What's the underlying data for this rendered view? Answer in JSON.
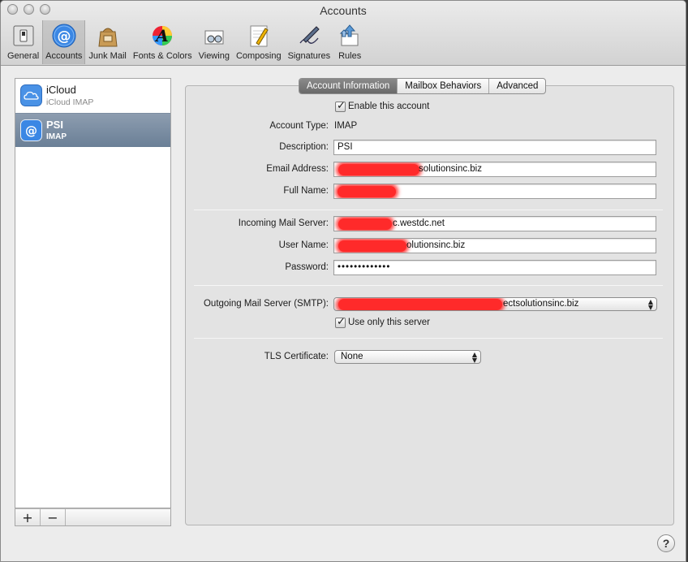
{
  "window": {
    "title": "Accounts"
  },
  "toolbar": {
    "items": [
      {
        "label": "General",
        "icon": "general-switch-icon"
      },
      {
        "label": "Accounts",
        "icon": "at-sign-icon",
        "selected": true
      },
      {
        "label": "Junk Mail",
        "icon": "junk-mail-bag-icon"
      },
      {
        "label": "Fonts & Colors",
        "icon": "fonts-colors-icon"
      },
      {
        "label": "Viewing",
        "icon": "viewing-glasses-icon"
      },
      {
        "label": "Composing",
        "icon": "composing-pencil-icon"
      },
      {
        "label": "Signatures",
        "icon": "signature-pen-icon"
      },
      {
        "label": "Rules",
        "icon": "rules-arrows-icon"
      }
    ]
  },
  "accounts": [
    {
      "name": "iCloud",
      "type": "iCloud IMAP",
      "icon": "icloud-icon"
    },
    {
      "name": "PSI",
      "type": "IMAP",
      "icon": "at-sign-icon",
      "selected": true
    }
  ],
  "list_footer": {
    "add": "+",
    "remove": "−"
  },
  "tabs": [
    {
      "label": "Account Information",
      "active": true
    },
    {
      "label": "Mailbox Behaviors"
    },
    {
      "label": "Advanced"
    }
  ],
  "form": {
    "enable_label": "Enable this account",
    "account_type_label": "Account Type:",
    "account_type_value": "IMAP",
    "description_label": "Description:",
    "description_value": "PSI",
    "email_label": "Email Address:",
    "email_value": "solutionsinc.biz",
    "fullname_label": "Full Name:",
    "fullname_value": "",
    "incoming_label": "Incoming Mail Server:",
    "incoming_value": "c.westdc.net",
    "username_label": "User Name:",
    "username_value": "olutionsinc.biz",
    "password_label": "Password:",
    "password_value": "•••••••••••••",
    "smtp_label": "Outgoing Mail Server (SMTP):",
    "smtp_value": "ectsolutionsinc.biz",
    "use_only_label": "Use only this server",
    "tls_label": "TLS Certificate:",
    "tls_value": "None"
  },
  "help": {
    "label": "?"
  },
  "colors": {
    "selection": "#7285a0",
    "redaction": "#ff2a2a",
    "accent": "#2f7de1"
  }
}
